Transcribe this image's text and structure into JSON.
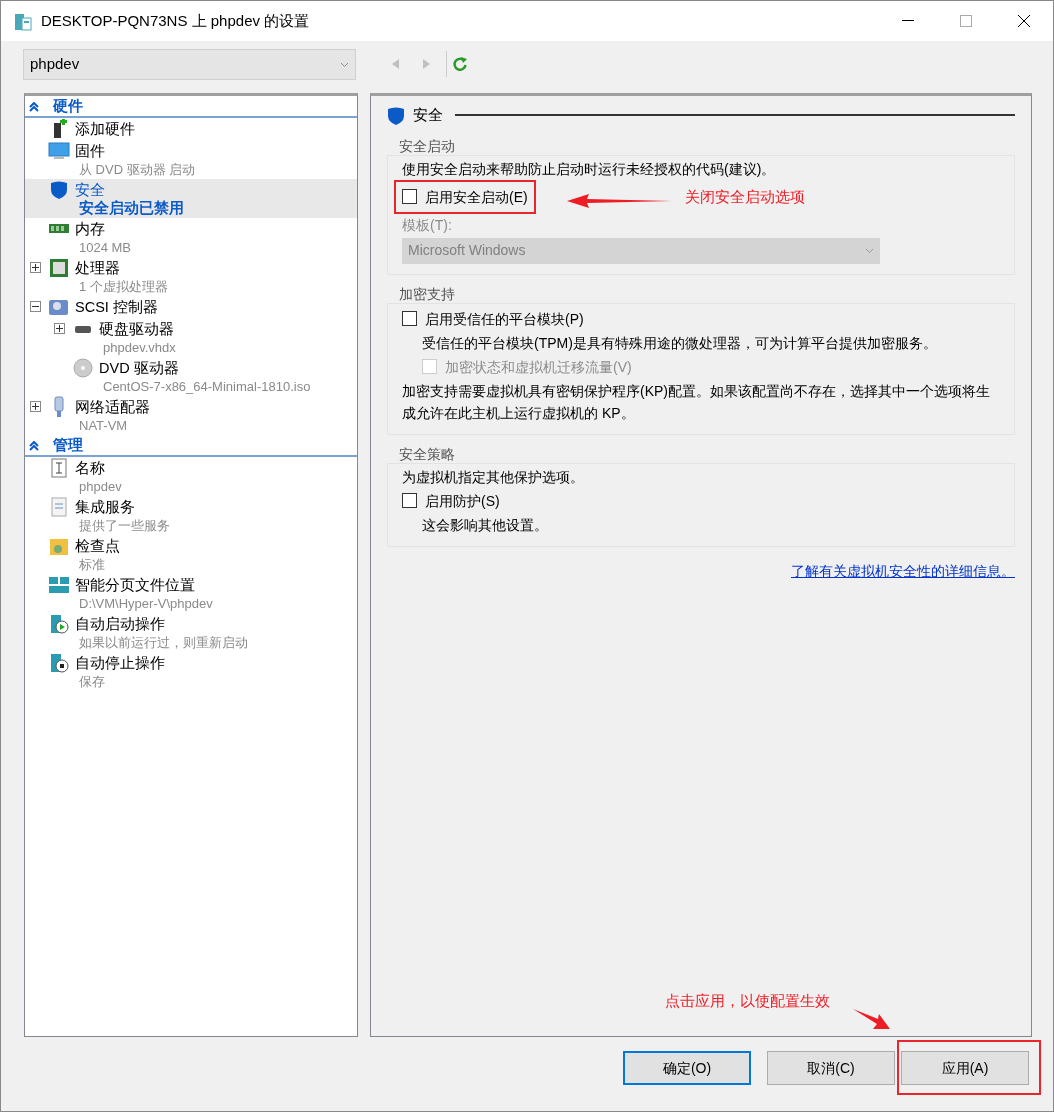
{
  "window": {
    "title": "DESKTOP-PQN73NS 上 phpdev 的设置"
  },
  "vm_selector": {
    "value": "phpdev"
  },
  "nav": [
    {
      "kind": "back",
      "disabled": true
    },
    {
      "kind": "forward",
      "disabled": true
    },
    {
      "kind": "refresh",
      "disabled": false
    }
  ],
  "tree": [
    {
      "label": "硬件",
      "expanded": true,
      "items": [
        {
          "label": "添加硬件",
          "selected": false
        },
        {
          "label": "固件",
          "detail": "从 DVD 驱动器 启动",
          "selected": false
        },
        {
          "label": "安全",
          "detail": "安全启动已禁用",
          "selected": true
        },
        {
          "label": "内存",
          "detail": "1024 MB",
          "selected": false
        },
        {
          "label": "处理器",
          "detail": "1 个虚拟处理器",
          "selected": false,
          "expanded": false
        },
        {
          "label": "SCSI 控制器",
          "selected": false,
          "expanded": true,
          "children": [
            {
              "label": "硬盘驱动器",
              "detail": "phpdev.vhdx",
              "selected": false,
              "expanded": false
            },
            {
              "label": "DVD 驱动器",
              "detail": "CentOS-7-x86_64-Minimal-1810.iso",
              "selected": false
            }
          ]
        },
        {
          "label": "网络适配器",
          "detail": "NAT-VM",
          "selected": false,
          "expanded": false
        }
      ]
    },
    {
      "label": "管理",
      "expanded": true,
      "items": [
        {
          "label": "名称",
          "detail": "phpdev",
          "selected": false
        },
        {
          "label": "集成服务",
          "detail": "提供了一些服务",
          "selected": false
        },
        {
          "label": "检查点",
          "detail": "标准",
          "selected": false
        },
        {
          "label": "智能分页文件位置",
          "detail": "D:\\VM\\Hyper-V\\phpdev",
          "selected": false
        },
        {
          "label": "自动启动操作",
          "detail": "如果以前运行过，则重新启动",
          "selected": false
        },
        {
          "label": "自动停止操作",
          "detail": "保存",
          "selected": false
        }
      ]
    }
  ],
  "page": {
    "title": "安全",
    "groups": [
      {
        "title": "安全启动",
        "content": [
          {
            "kind": "text",
            "text": "使用安全启动来帮助防止启动时运行未经授权的代码(建议)。"
          },
          {
            "kind": "checkbox",
            "label": "启用安全启动(E)",
            "checked": false,
            "disabled": false
          },
          {
            "kind": "select",
            "label": "模板(T):",
            "value": "Microsoft Windows",
            "disabled": true
          }
        ]
      },
      {
        "title": "加密支持",
        "content": [
          {
            "kind": "checkbox",
            "label": "启用受信任的平台模块(P)",
            "checked": false,
            "disabled": false
          },
          {
            "kind": "note",
            "text": "受信任的平台模块(TPM)是具有特殊用途的微处理器，可为计算平台提供加密服务。"
          },
          {
            "kind": "subcheckbox",
            "label": "加密状态和虚拟机迁移流量(V)",
            "checked": false,
            "disabled": true
          },
          {
            "kind": "text",
            "text": "加密支持需要虚拟机具有密钥保护程序(KP)配置。如果该配置尚不存在，选择其中一个选项将生成允许在此主机上运行虚拟机的 KP。"
          }
        ]
      },
      {
        "title": "安全策略",
        "content": [
          {
            "kind": "text",
            "text": "为虚拟机指定其他保护选项。"
          },
          {
            "kind": "checkbox",
            "label": "启用防护(S)",
            "checked": false,
            "disabled": false
          },
          {
            "kind": "note",
            "text": "这会影响其他设置。"
          }
        ]
      }
    ],
    "link": "了解有关虚拟机安全性的详细信息。"
  },
  "buttons": [
    {
      "label": "确定(O)",
      "default": true
    },
    {
      "label": "取消(C)",
      "default": false
    },
    {
      "label": "应用(A)",
      "default": false
    }
  ],
  "annotations": [
    {
      "kind": "checkbox",
      "text": "关闭安全启动选项"
    },
    {
      "kind": "button",
      "text": "点击应用，以使配置生效"
    }
  ]
}
